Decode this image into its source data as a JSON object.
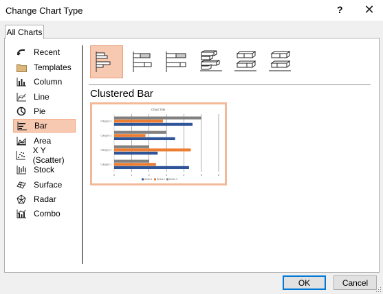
{
  "dialog": {
    "title": "Change Chart Type",
    "help_label": "?",
    "close_label": "✕"
  },
  "tabs": [
    {
      "label": "All Charts"
    }
  ],
  "sidebar": {
    "items": [
      {
        "label": "Recent",
        "icon": "recent-icon"
      },
      {
        "label": "Templates",
        "icon": "folder-icon"
      },
      {
        "label": "Column",
        "icon": "column-chart-icon"
      },
      {
        "label": "Line",
        "icon": "line-chart-icon"
      },
      {
        "label": "Pie",
        "icon": "pie-chart-icon"
      },
      {
        "label": "Bar",
        "icon": "bar-chart-icon",
        "selected": true
      },
      {
        "label": "Area",
        "icon": "area-chart-icon"
      },
      {
        "label": "X Y (Scatter)",
        "icon": "scatter-chart-icon"
      },
      {
        "label": "Stock",
        "icon": "stock-chart-icon"
      },
      {
        "label": "Surface",
        "icon": "surface-chart-icon"
      },
      {
        "label": "Radar",
        "icon": "radar-chart-icon"
      },
      {
        "label": "Combo",
        "icon": "combo-chart-icon"
      }
    ]
  },
  "subtypes": [
    {
      "name": "clustered-bar",
      "selected": true
    },
    {
      "name": "stacked-bar"
    },
    {
      "name": "100-stacked-bar"
    },
    {
      "name": "3d-clustered-bar"
    },
    {
      "name": "3d-stacked-bar"
    },
    {
      "name": "3d-100-stacked-bar"
    }
  ],
  "main": {
    "chart_type_title": "Clustered Bar"
  },
  "preview": {
    "chart_data": {
      "type": "bar",
      "title": "Chart Title",
      "categories": [
        "Category 1",
        "Category 2",
        "Category 3",
        "Category 4"
      ],
      "series": [
        {
          "name": "Series 1",
          "color": "#2e5597",
          "values": [
            4.3,
            2.5,
            3.5,
            4.5
          ]
        },
        {
          "name": "Series 2",
          "color": "#ed7d31",
          "values": [
            2.4,
            4.4,
            1.8,
            2.8
          ]
        },
        {
          "name": "Series 3",
          "color": "#808080",
          "values": [
            2,
            2,
            3,
            5
          ]
        }
      ],
      "xlim": [
        0,
        6
      ],
      "x_ticks": [
        "0",
        "1",
        "2",
        "3",
        "4",
        "5",
        "6"
      ],
      "legend": "bottom",
      "grid": true
    }
  },
  "buttons": {
    "ok_label": "OK",
    "cancel_label": "Cancel"
  }
}
